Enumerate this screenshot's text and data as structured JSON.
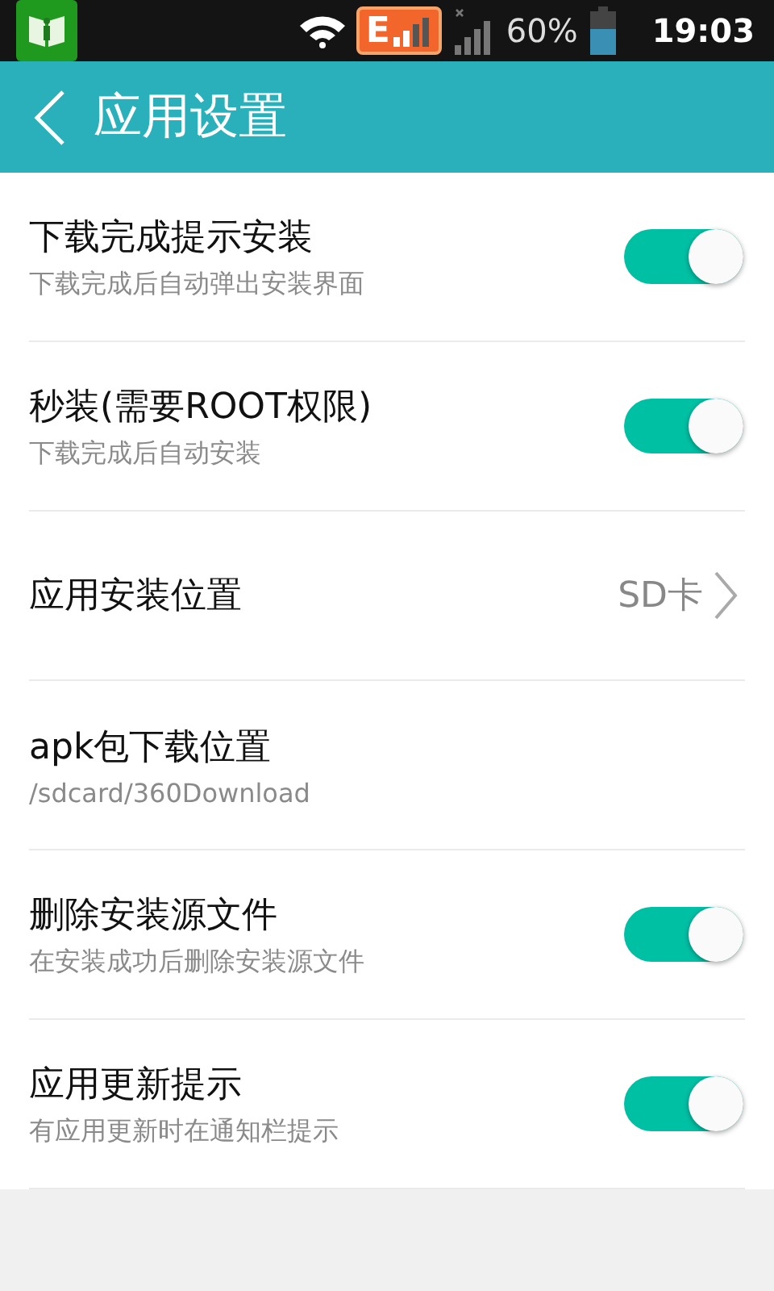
{
  "status_bar": {
    "network_badge": "E",
    "battery": "60%",
    "time": "19:03"
  },
  "header": {
    "title": "应用设置"
  },
  "settings": [
    {
      "kind": "toggle",
      "title": "下载完成提示安装",
      "subtitle": "下载完成后自动弹出安装界面",
      "on": true
    },
    {
      "kind": "toggle",
      "title": "秒装(需要ROOT权限)",
      "subtitle": "下载完成后自动安装",
      "on": true
    },
    {
      "kind": "value",
      "title": "应用安装位置",
      "value": "SD卡"
    },
    {
      "kind": "info",
      "title": "apk包下载位置",
      "subtitle": "/sdcard/360Download"
    },
    {
      "kind": "toggle",
      "title": "删除安装源文件",
      "subtitle": "在安装成功后删除安装源文件",
      "on": true
    },
    {
      "kind": "toggle",
      "title": "应用更新提示",
      "subtitle": "有应用更新时在通知栏提示",
      "on": true
    }
  ]
}
